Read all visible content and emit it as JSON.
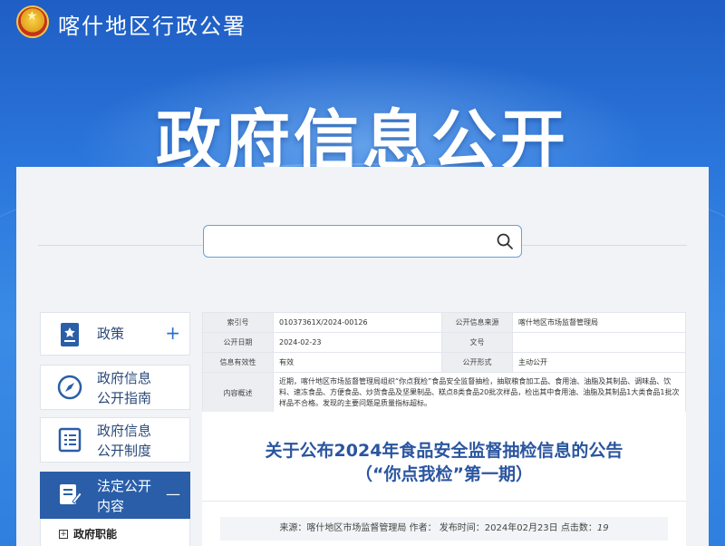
{
  "header": {
    "site_title": "喀什地区行政公署",
    "banner_title": "政府信息公开"
  },
  "search": {
    "value": "",
    "placeholder": ""
  },
  "sidebar": {
    "items": [
      {
        "label_line1": "政策",
        "label_line2": "",
        "toggle": "+",
        "icon": "policy-document-icon"
      },
      {
        "label_line1": "政府信息",
        "label_line2": "公开指南",
        "icon": "compass-icon"
      },
      {
        "label_line1": "政府信息",
        "label_line2": "公开制度",
        "icon": "list-document-icon"
      },
      {
        "label_line1": "法定公开",
        "label_line2": "内容",
        "toggle": "—",
        "icon": "edit-document-icon",
        "active": true
      }
    ],
    "sub_items": [
      {
        "label": "政府职能",
        "toggle": "+"
      }
    ]
  },
  "info": {
    "index_label": "索引号",
    "index_value": "01037361X/2024-00126",
    "source_label": "公开信息来源",
    "source_value": "喀什地区市场监督管理局",
    "date_label": "公开日期",
    "date_value": "2024-02-23",
    "docno_label": "文号",
    "docno_value": "",
    "validity_label": "信息有效性",
    "validity_value": "有效",
    "form_label": "公开形式",
    "form_value": "主动公开",
    "summary_label": "内容概述",
    "summary_value": "近期，喀什地区市场监督管理局组织“你点我检”食品安全监督抽检，抽取粮食加工品、食用油、油脂及其制品、调味品、饮料、速冻食品、方便食品、炒货食品及坚果制品、糕点8类食品20批次样品，检出其中食用油、油脂及其制品1大类食品1批次样品不合格。发现的主要问题是质量指标超标。"
  },
  "article": {
    "title_line1": "关于公布2024年食品安全监督抽检信息的公告",
    "title_line2": "（“你点我检”第一期）",
    "meta_source_label": "来源：",
    "meta_source": "喀什地区市场监督管理局",
    "meta_author_label": "作者：",
    "meta_time_label": "发布时间：",
    "meta_time": "2024年02月23日",
    "meta_views_label": "点击数：",
    "meta_views": "19"
  },
  "colors": {
    "brand_blue": "#2a5ea8",
    "title_blue": "#2a55a0",
    "hero_blue": "#2a76dc"
  }
}
